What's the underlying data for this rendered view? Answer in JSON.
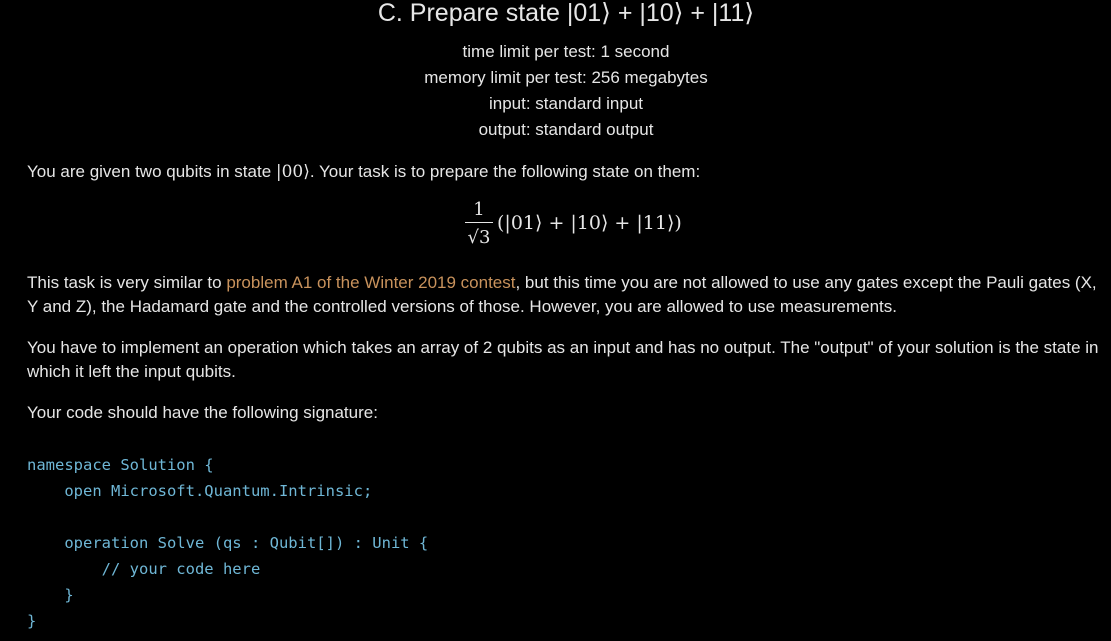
{
  "problem": {
    "title": "C. Prepare state |01⟩ + |10⟩ + |11⟩",
    "limits": {
      "time": "time limit per test: 1 second",
      "memory": "memory limit per test: 256 megabytes",
      "input": "input: standard input",
      "output": "output: standard output"
    }
  },
  "statement": {
    "p1_before": "You are given two qubits in state ",
    "p1_state": "|00⟩",
    "p1_after": ". Your task is to prepare the following state on them:",
    "formula": {
      "numerator": "1",
      "denominator": "√3",
      "kets": "(|01⟩ + |10⟩ + |11⟩)"
    },
    "p2_before": "This task is very similar to ",
    "p2_link": "problem A1 of the Winter 2019 contest",
    "p2_after": ", but this time you are not allowed to use any gates except the Pauli gates (X, Y and Z), the Hadamard gate and the controlled versions of those. However, you are allowed to use measurements.",
    "p3": "You have to implement an operation which takes an array of 2 qubits as an input and has no output. The \"output\" of your solution is the state in which it left the input qubits.",
    "p4": "Your code should have the following signature:"
  },
  "code": {
    "lines": [
      "namespace Solution {",
      "    open Microsoft.Quantum.Intrinsic;",
      "",
      "    operation Solve (qs : Qubit[]) : Unit {",
      "        // your code here",
      "    }",
      "}"
    ]
  }
}
